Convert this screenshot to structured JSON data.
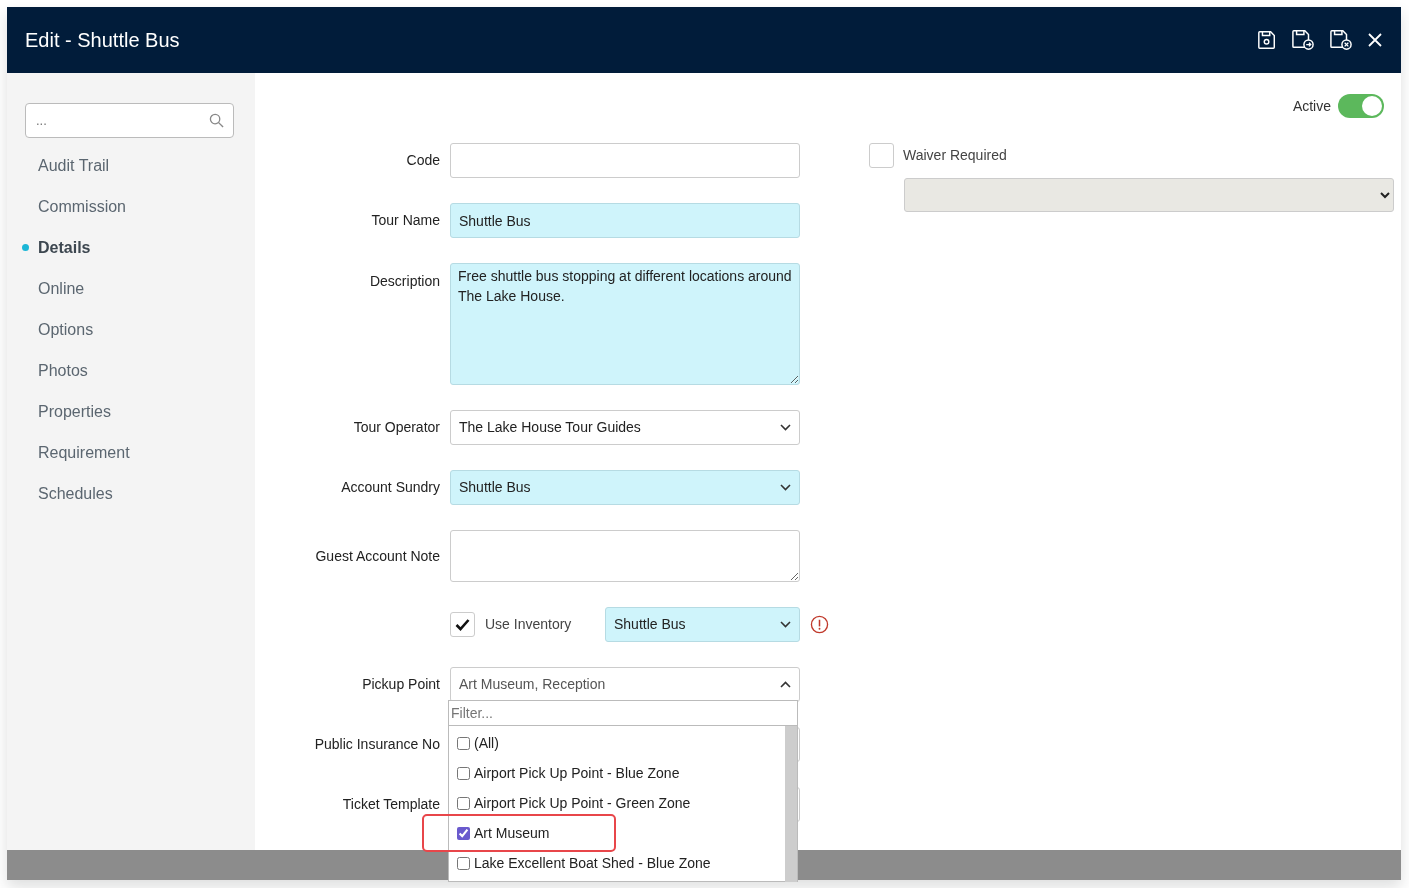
{
  "window": {
    "title": "Edit - Shuttle Bus"
  },
  "toolbar": [
    {
      "kind": "save"
    },
    {
      "kind": "save-forward"
    },
    {
      "kind": "save-cancel"
    },
    {
      "kind": "close"
    }
  ],
  "sidebar": {
    "search": {
      "placeholder": "..."
    },
    "items": [
      {
        "label": "Audit Trail",
        "selected": false
      },
      {
        "label": "Commission",
        "selected": false
      },
      {
        "label": "Details",
        "selected": true
      },
      {
        "label": "Online",
        "selected": false
      },
      {
        "label": "Options",
        "selected": false
      },
      {
        "label": "Photos",
        "selected": false
      },
      {
        "label": "Properties",
        "selected": false
      },
      {
        "label": "Requirement",
        "selected": false
      },
      {
        "label": "Schedules",
        "selected": false
      }
    ]
  },
  "active": {
    "label": "Active",
    "on": true
  },
  "waiver": {
    "label": "Waiver Required",
    "checked": false
  },
  "form": {
    "fields": [
      {
        "kind": "input",
        "label": "Code",
        "highlighted": false
      },
      {
        "kind": "input",
        "label": "Tour Name",
        "value": "Shuttle Bus",
        "highlighted": true
      },
      {
        "kind": "textarea",
        "label": "Description",
        "value": "Free shuttle bus stopping at different locations around The Lake House.",
        "highlighted": true
      },
      {
        "kind": "select",
        "label": "Tour Operator",
        "value": "The Lake House Tour Guides",
        "highlighted": false
      },
      {
        "kind": "select",
        "label": "Account Sundry",
        "value": "Shuttle Bus",
        "highlighted": true
      },
      {
        "kind": "note",
        "label": "Guest Account Note",
        "highlighted": false
      },
      {
        "kind": "inventory",
        "label": "Use Inventory",
        "checked": true,
        "value": "Shuttle Bus",
        "highlighted": true
      },
      {
        "kind": "multiselect",
        "label": "Pickup Point",
        "value": "Art Museum, Reception",
        "highlighted": false,
        "expanded": true,
        "filter": {
          "placeholder": "Filter..."
        },
        "options": [
          {
            "label": "(All)",
            "checked": false,
            "highlighted": false
          },
          {
            "label": "Airport Pick Up Point - Blue Zone",
            "checked": false,
            "highlighted": false
          },
          {
            "label": "Airport Pick Up Point - Green Zone",
            "checked": false,
            "highlighted": false
          },
          {
            "label": "Art Museum",
            "checked": true,
            "highlighted": true
          },
          {
            "label": "Lake Excellent Boat Shed - Blue Zone",
            "checked": false,
            "highlighted": false
          }
        ]
      },
      {
        "kind": "input",
        "label": "Public Insurance No",
        "highlighted": false
      },
      {
        "kind": "input",
        "label": "Ticket Template",
        "highlighted": false
      }
    ]
  }
}
